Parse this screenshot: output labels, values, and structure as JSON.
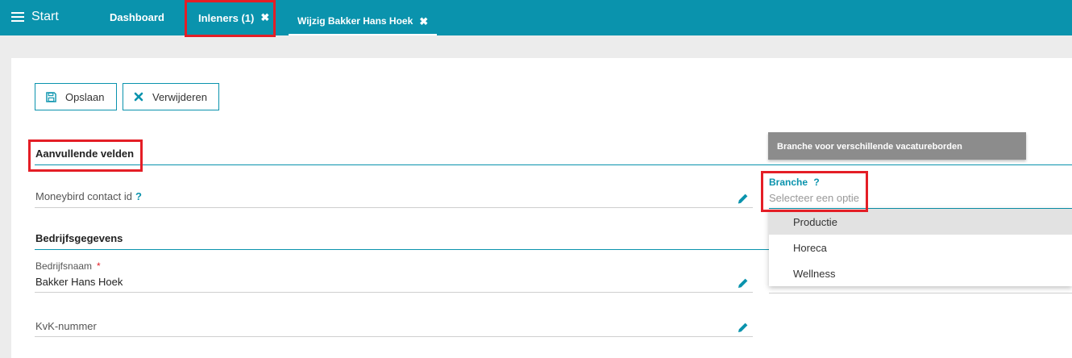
{
  "topbar": {
    "start_label": "Start",
    "tabs": [
      {
        "label": "Dashboard"
      },
      {
        "label": "Inleners (1)",
        "close": "✖"
      },
      {
        "label": "Wijzig Bakker Hans Hoek",
        "close": "✖"
      }
    ],
    "color": "#0a93ad"
  },
  "toolbar": {
    "save_label": "Opslaan",
    "delete_label": "Verwijderen"
  },
  "sections": {
    "aanvullende": {
      "title": "Aanvullende velden",
      "moneybird_label": "Moneybird contact id",
      "help": "?"
    },
    "bedrijf": {
      "title": "Bedrijfsgegevens",
      "bedrijfsnaam_label": "Bedrijfsnaam",
      "required": "*",
      "bedrijfsnaam_value": "Bakker Hans Hoek",
      "kvk_label": "KvK-nummer"
    }
  },
  "branche": {
    "tooltip": "Branche voor verschillende vacatureborden",
    "label": "Branche",
    "help": "?",
    "placeholder": "Selecteer een optie",
    "options": [
      "Productie",
      "Horeca",
      "Wellness"
    ]
  },
  "icons": {
    "menu": "hamburger-icon",
    "close": "close-icon",
    "save": "floppy-disk-icon",
    "delete": "close-icon",
    "edit": "pencil-icon"
  },
  "colors": {
    "accent": "#0a93ad",
    "highlight": "#e41e26",
    "required": "#e41e26"
  }
}
